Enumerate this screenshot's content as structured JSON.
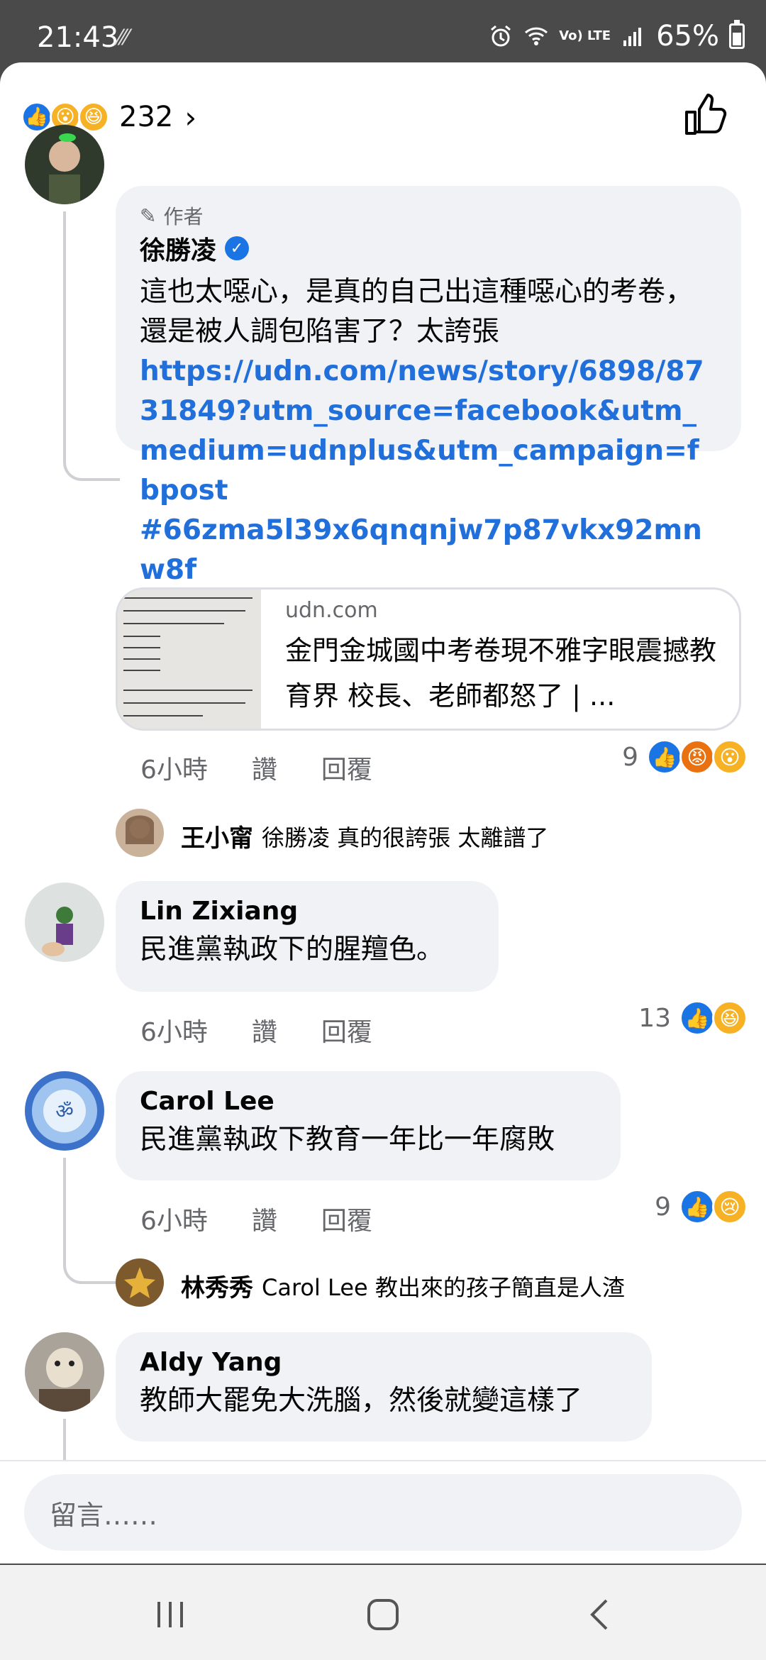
{
  "status_bar": {
    "time": "21:43",
    "lte": "Vo) LTE",
    "battery": "65%"
  },
  "reactions_header": {
    "count": "232",
    "icons": [
      "like",
      "wow",
      "haha"
    ]
  },
  "comments": [
    {
      "author_tag": "作者",
      "name": "徐勝凌",
      "verified": true,
      "text": "這也太噁心，是真的自己出這種噁心的考卷，還是被人調包陷害了？太誇張",
      "link": "https://udn.com/news/story/6898/8731849?utm_source=facebook&utm_medium=udnplus&utm_campaign=fbpost",
      "hashtag": "#66zma5l39x6qnqnjw7p87vkx92mnw8f",
      "link_card": {
        "domain": "udn.com",
        "title": "金門金城國中考卷現不雅字眼震撼教育界 校長、老師都怒了 | ..."
      },
      "time": "6小時",
      "like_label": "讚",
      "reply_label": "回覆",
      "reaction_count": "9",
      "reaction_icons": [
        "like",
        "angry",
        "wow"
      ],
      "replies": [
        {
          "name": "王小甯",
          "text": "徐勝凌 真的很誇張 太離譜了"
        }
      ]
    },
    {
      "name": "Lin Zixiang",
      "text": "民進黨執政下的腥羶色。",
      "time": "6小時",
      "like_label": "讚",
      "reply_label": "回覆",
      "reaction_count": "13",
      "reaction_icons": [
        "like",
        "haha"
      ]
    },
    {
      "name": "Carol Lee",
      "text": "民進黨執政下教育一年比一年腐敗",
      "time": "6小時",
      "like_label": "讚",
      "reply_label": "回覆",
      "reaction_count": "9",
      "reaction_icons": [
        "like",
        "sad"
      ],
      "replies": [
        {
          "name": "林秀秀",
          "text": "Carol Lee 教出來的孩子簡直是人渣"
        }
      ]
    },
    {
      "name": "Aldy Yang",
      "text": "教師大罷免大洗腦，然後就變這樣了"
    }
  ],
  "composer": {
    "placeholder": "留言……"
  },
  "colors": {
    "accent": "#1b74e4",
    "link": "#216fdb",
    "bubble": "#f0f2f5"
  }
}
